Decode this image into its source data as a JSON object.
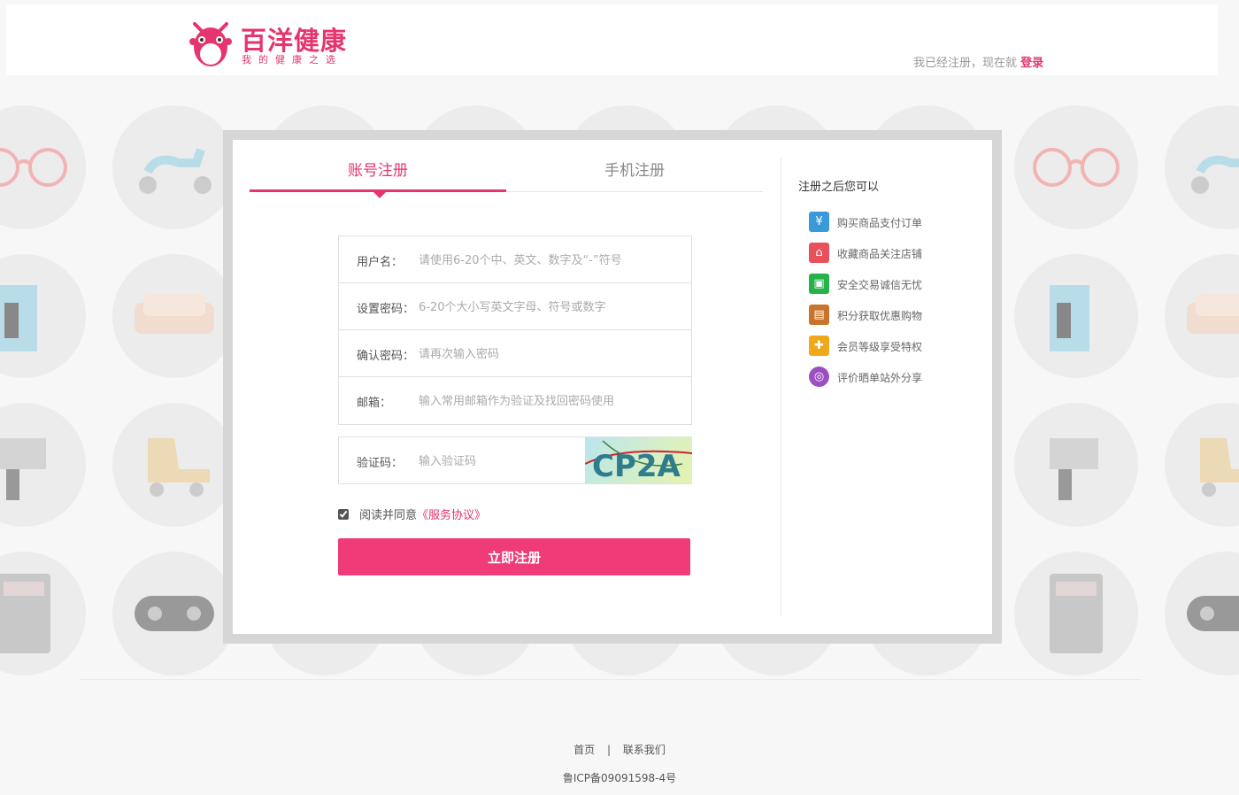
{
  "header": {
    "brand_name": "百洋健康",
    "brand_slogan": "我的健康之选",
    "login_prompt": "我已经注册，现在就",
    "login_link": "登录",
    "brand_color": "#e6346e"
  },
  "tabs": {
    "account_register": "账号注册",
    "phone_register": "手机注册"
  },
  "form": {
    "username": {
      "label": "用户名：",
      "placeholder": "请使用6-20个中、英文、数字及“-”符号"
    },
    "password": {
      "label": "设置密码：",
      "placeholder": "6-20个大小写英文字母、符号或数字"
    },
    "confirm_password": {
      "label": "确认密码：",
      "placeholder": "请再次输入密码"
    },
    "email": {
      "label": "邮箱：",
      "placeholder": "输入常用邮箱作为验证及找回密码使用"
    },
    "captcha": {
      "label": "验证码：",
      "placeholder": "输入验证码",
      "image_text": "CP2A"
    },
    "agree": {
      "text": "阅读并同意",
      "terms_link": "《服务协议》",
      "checked": true
    },
    "submit_label": "立即注册"
  },
  "benefits": {
    "title": "注册之后您可以",
    "items": [
      {
        "label": "购买商品支付订单",
        "icon": "cashier-icon",
        "color": "#3a9ad9"
      },
      {
        "label": "收藏商品关注店铺",
        "icon": "store-icon",
        "color": "#e8505b"
      },
      {
        "label": "安全交易诚信无忧",
        "icon": "wallet-icon",
        "color": "#27b14a"
      },
      {
        "label": "积分获取优惠购物",
        "icon": "gift-card-icon",
        "color": "#c9742b"
      },
      {
        "label": "会员等级享受特权",
        "icon": "gift-box-icon",
        "color": "#f0a81b"
      },
      {
        "label": "评价晒单站外分享",
        "icon": "share-globe-icon",
        "color": "#9b4fc0"
      }
    ]
  },
  "footer": {
    "home_link": "首页",
    "separator": "|",
    "contact_link": "联系我们",
    "icp": "鲁ICP备09091598-4号"
  }
}
